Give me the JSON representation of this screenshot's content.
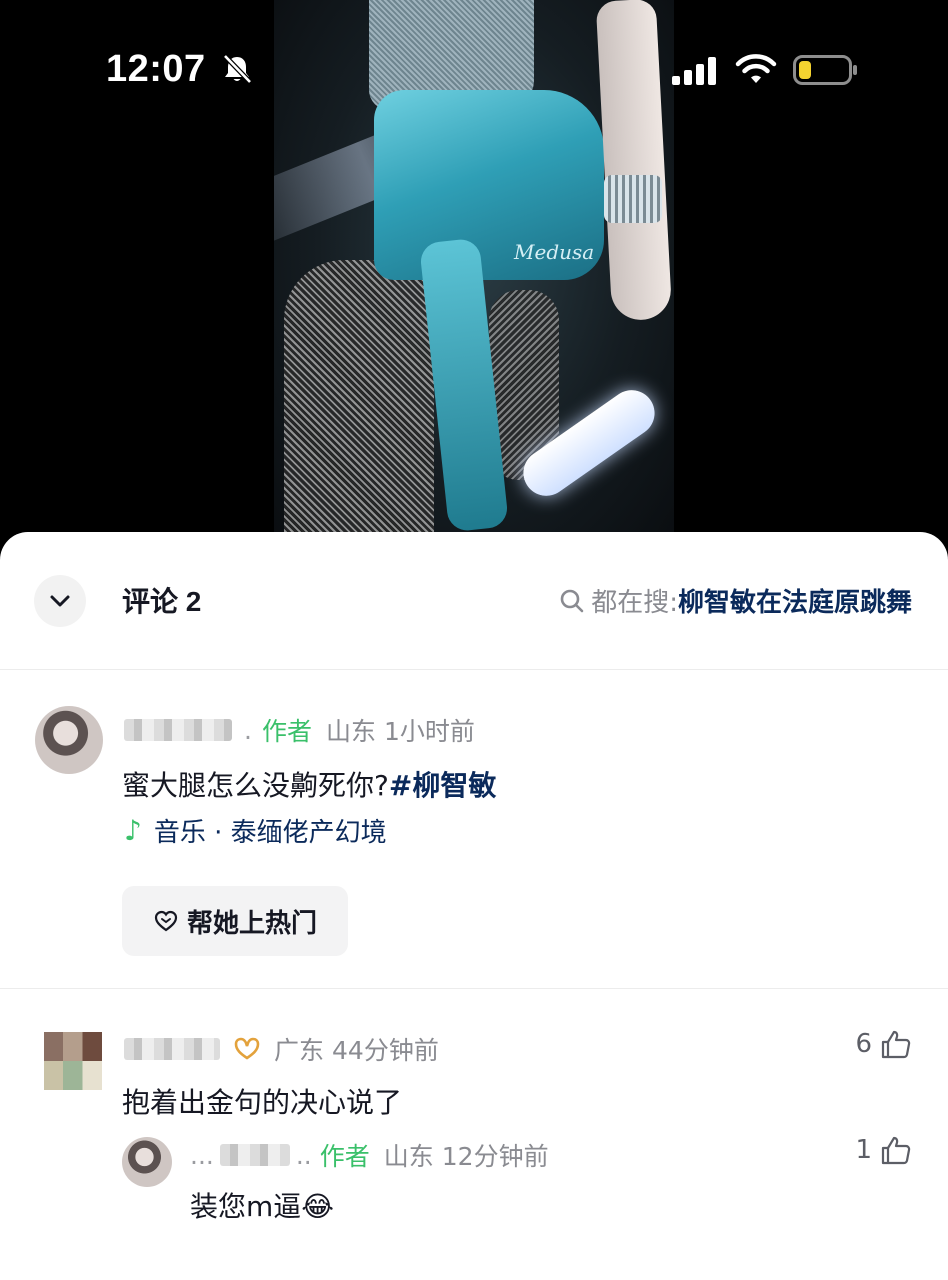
{
  "status_bar": {
    "time": "12:07",
    "icons": [
      "bell-slash-icon",
      "signal-icon",
      "wifi-icon",
      "battery-low-icon"
    ]
  },
  "video": {
    "overlay_text": "Medusa"
  },
  "sheet": {
    "title": "评论 2",
    "search_prefix": "都在搜:",
    "search_term": "柳智敏在法庭原跳舞"
  },
  "comments": [
    {
      "name_visible": ".",
      "author_tag": "作者",
      "location": "山东",
      "time": "1小时前",
      "text_plain": "蜜大腿怎么没齁死你?",
      "hashtag": "#柳智敏",
      "music_label": "音乐 · 泰缅佬产幻境",
      "boost_label": "帮她上热门"
    },
    {
      "location": "广东",
      "time": "44分钟前",
      "text": "抱着出金句的决心说了",
      "likes": "6",
      "reply": {
        "name_prefix": "...",
        "name_suffix": "..",
        "author_tag": "作者",
        "location": "山东",
        "time": "12分钟前",
        "text": "装您m逼",
        "emoji": "😂",
        "likes": "1"
      }
    }
  ],
  "colors": {
    "accent_green": "#3ac06a",
    "link_navy": "#0b2a5b",
    "meta_gray": "#8a8b91",
    "battery_yellow": "#f5d330"
  }
}
